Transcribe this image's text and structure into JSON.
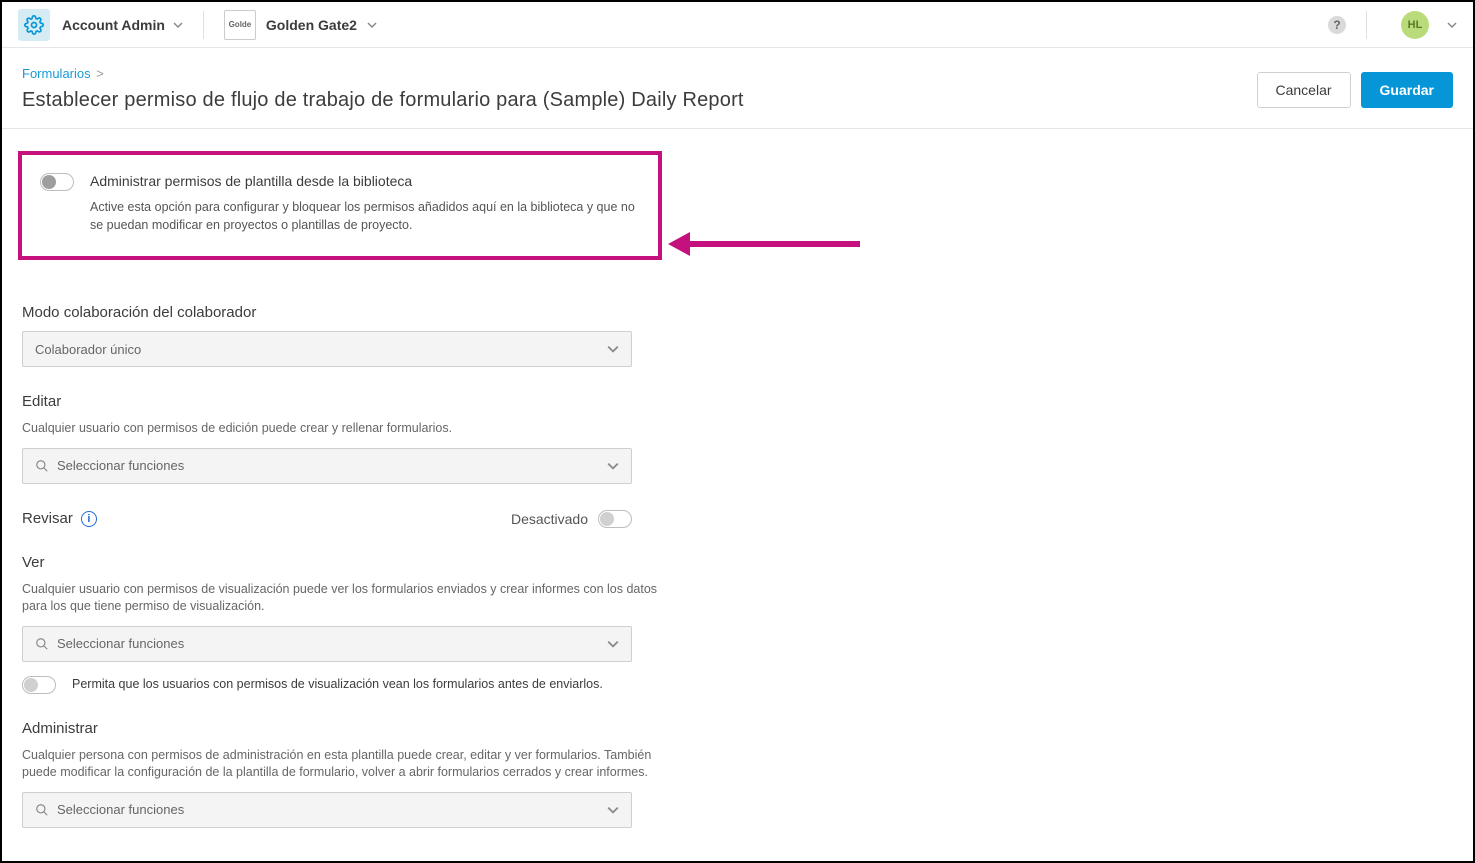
{
  "top": {
    "admin_label": "Account Admin",
    "project_thumb_alt": "Golde",
    "project_name": "Golden Gate2",
    "avatar_initials": "HL"
  },
  "breadcrumbs": {
    "root": "Formularios",
    "sep": ">"
  },
  "page_title": "Establecer permiso de flujo de trabajo de formulario para (Sample) Daily Report",
  "actions": {
    "cancel": "Cancelar",
    "save": "Guardar"
  },
  "manage_template": {
    "title": "Administrar permisos de plantilla desde la biblioteca",
    "desc": "Active esta opción para configurar y bloquear los permisos añadidos aquí en la biblioteca y que no se puedan modificar en proyectos o plantillas de proyecto."
  },
  "collab": {
    "label": "Modo colaboración del colaborador",
    "selected": "Colaborador único"
  },
  "edit": {
    "label": "Editar",
    "desc": "Cualquier usuario con permisos de edición puede crear y rellenar formularios.",
    "placeholder": "Seleccionar funciones"
  },
  "review": {
    "label": "Revisar",
    "state_label": "Desactivado"
  },
  "view": {
    "label": "Ver",
    "desc": "Cualquier usuario con permisos de visualización puede ver los formularios enviados y crear informes con los datos para los que tiene permiso de visualización.",
    "placeholder": "Seleccionar funciones",
    "allow_desc": "Permita que los usuarios con permisos de visualización vean los formularios antes de enviarlos."
  },
  "admin": {
    "label": "Administrar",
    "desc": "Cualquier persona con permisos de administración en esta plantilla puede crear, editar y ver formularios. También puede modificar la configuración de la plantilla de formulario, volver a abrir formularios cerrados y crear informes.",
    "placeholder": "Seleccionar funciones"
  }
}
